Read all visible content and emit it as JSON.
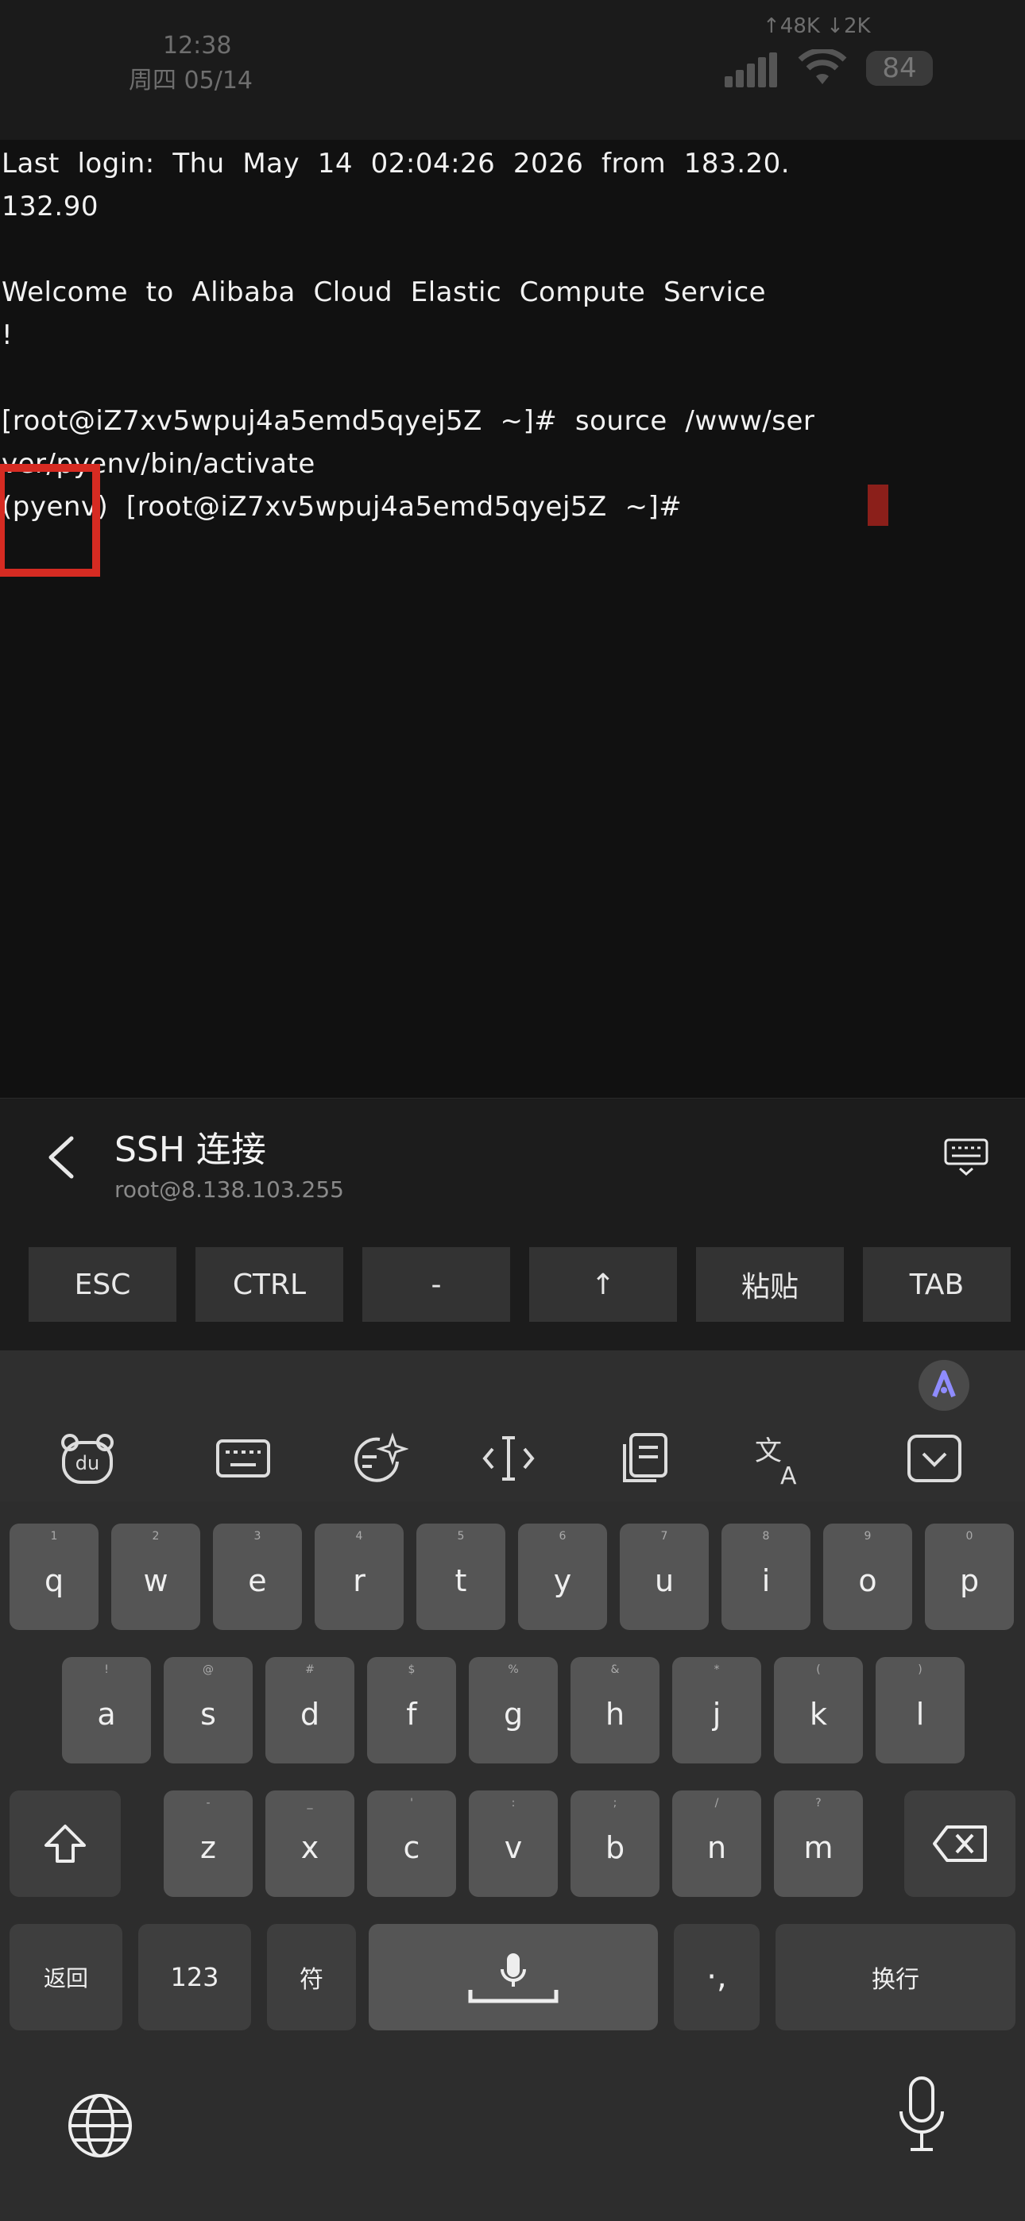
{
  "status_bar": {
    "time": "12:38",
    "date": "周四 05/14",
    "network_speed": "↑48K ↓2K",
    "battery": "84"
  },
  "terminal": {
    "lines": [
      "Last  login:  Thu  May  14  02:04:26  2026  from  183.20.",
      "132.90",
      "",
      "Welcome  to  Alibaba  Cloud  Elastic  Compute  Service",
      "!",
      "",
      "[root@iZ7xv5wpuj4a5emd5qyej5Z  ~]#  source  /www/ser",
      "ver/pyenv/bin/activate",
      "(pyenv)  [root@iZ7xv5wpuj4a5emd5qyej5Z  ~]#"
    ]
  },
  "session": {
    "title": "SSH 连接",
    "subtitle": "root@8.138.103.255"
  },
  "special_keys": [
    "ESC",
    "CTRL",
    "-",
    "↑",
    "粘贴",
    "TAB"
  ],
  "keyboard": {
    "row1": [
      {
        "k": "q",
        "h": "1"
      },
      {
        "k": "w",
        "h": "2"
      },
      {
        "k": "e",
        "h": "3"
      },
      {
        "k": "r",
        "h": "4"
      },
      {
        "k": "t",
        "h": "5"
      },
      {
        "k": "y",
        "h": "6"
      },
      {
        "k": "u",
        "h": "7"
      },
      {
        "k": "i",
        "h": "8"
      },
      {
        "k": "o",
        "h": "9"
      },
      {
        "k": "p",
        "h": "0"
      }
    ],
    "row2": [
      {
        "k": "a",
        "h": "!"
      },
      {
        "k": "s",
        "h": "@"
      },
      {
        "k": "d",
        "h": "#"
      },
      {
        "k": "f",
        "h": "$"
      },
      {
        "k": "g",
        "h": "%"
      },
      {
        "k": "h",
        "h": "&"
      },
      {
        "k": "j",
        "h": "*"
      },
      {
        "k": "k",
        "h": "("
      },
      {
        "k": "l",
        "h": ")"
      }
    ],
    "row3": [
      {
        "k": "z",
        "h": "-"
      },
      {
        "k": "x",
        "h": "_"
      },
      {
        "k": "c",
        "h": "'"
      },
      {
        "k": "v",
        "h": ":"
      },
      {
        "k": "b",
        "h": ";"
      },
      {
        "k": "n",
        "h": "/"
      },
      {
        "k": "m",
        "h": "?"
      }
    ],
    "return_label": "返回",
    "num_label": "123",
    "symbol_label": "符",
    "punct_label": "·,",
    "enter_label": "换行"
  }
}
